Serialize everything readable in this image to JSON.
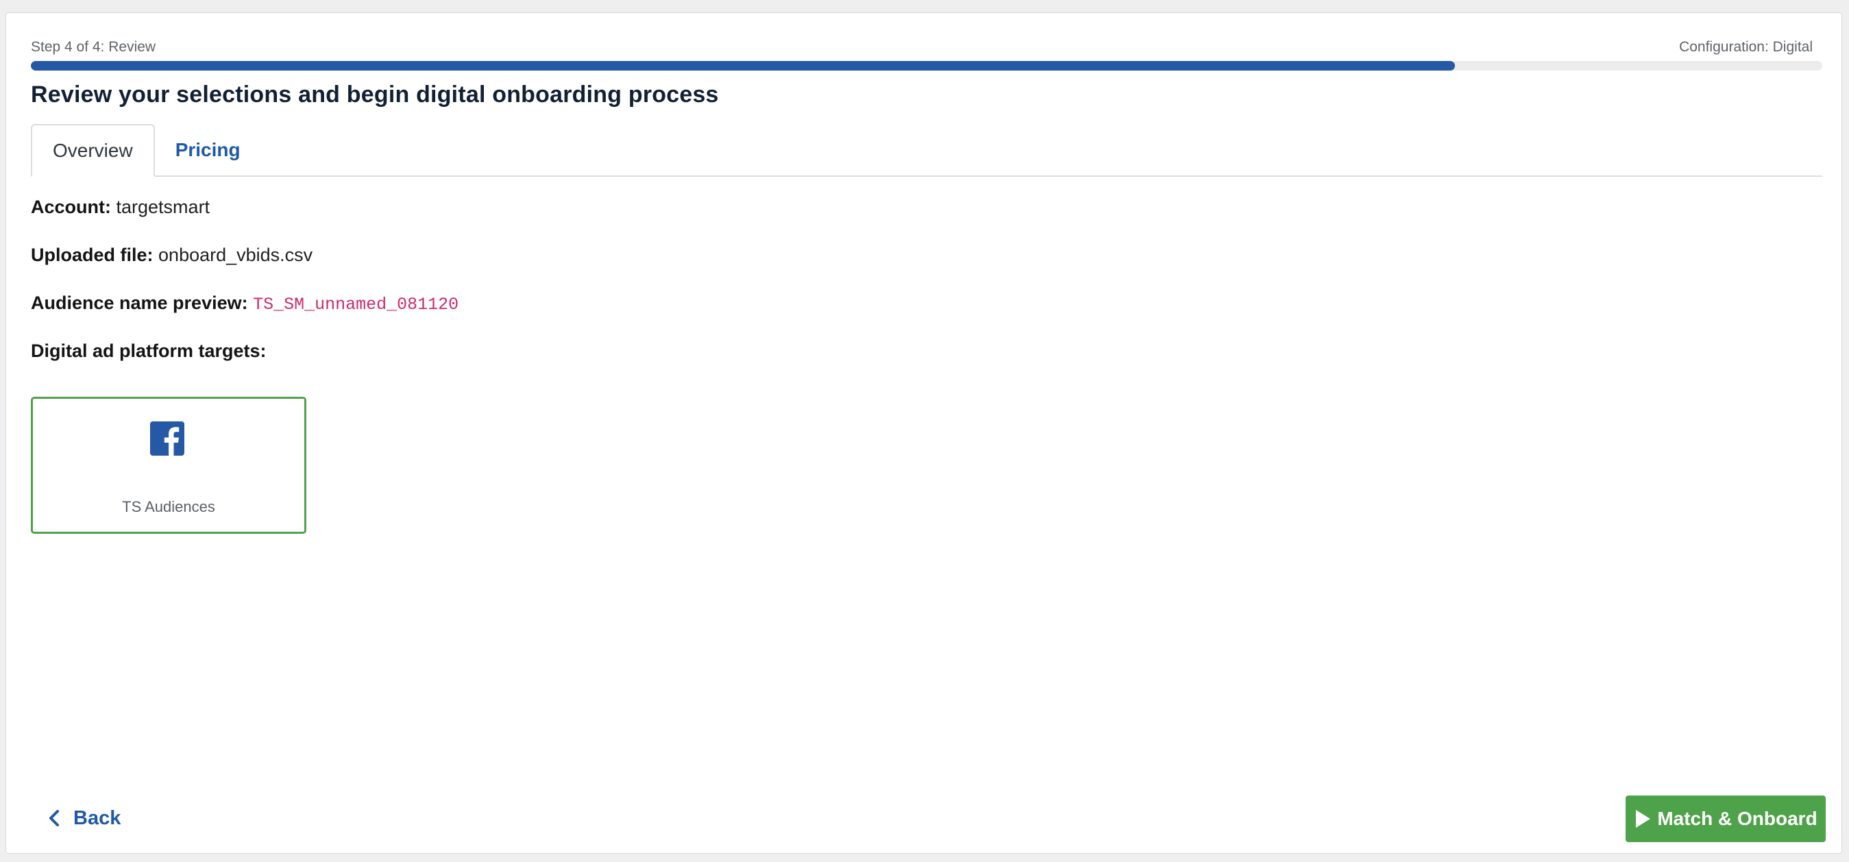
{
  "progress": {
    "step_text": "Step 4 of 4: Review",
    "configuration_text": "Configuration: Digital",
    "percent": 79.5,
    "colors": {
      "fill": "#2559a5",
      "track": "#ececec"
    }
  },
  "page": {
    "title": "Review your selections and begin digital onboarding process"
  },
  "tabs": [
    {
      "label": "Overview",
      "active": true
    },
    {
      "label": "Pricing",
      "active": false
    }
  ],
  "details": {
    "account_label": "Account:",
    "account_value": "targetsmart",
    "file_label": "Uploaded file:",
    "file_value": "onboard_vbids.csv",
    "audience_label": "Audience name preview:",
    "audience_value": "TS_SM_unnamed_081120",
    "targets_label": "Digital ad platform targets:"
  },
  "targets": [
    {
      "icon": "facebook-icon",
      "label": "TS Audiences",
      "selected": true
    }
  ],
  "footer": {
    "back_label": "Back",
    "primary_label": "Match & Onboard",
    "primary_color": "#4ea249"
  }
}
